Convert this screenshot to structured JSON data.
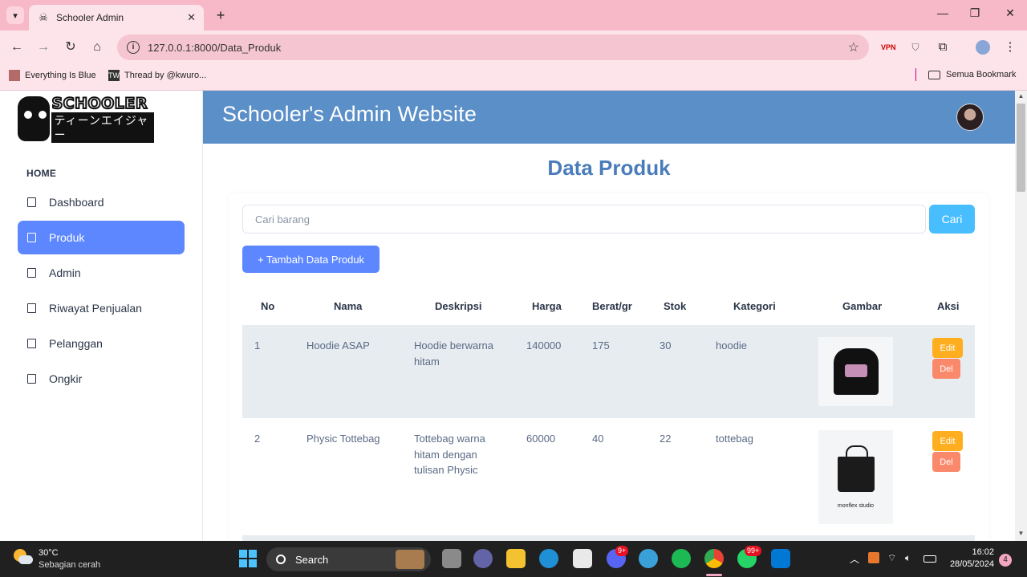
{
  "browser": {
    "tab_title": "Schooler Admin",
    "url": "127.0.0.1:8000/Data_Produk",
    "bookmarks": [
      "Everything Is Blue",
      "Thread by @kwuro..."
    ],
    "all_bookmarks_label": "Semua Bookmark"
  },
  "sidebar": {
    "logo_text": "SCHOOLER",
    "logo_subtext": "ティーンエイジャー",
    "section_heading": "HOME",
    "items": [
      {
        "label": "Dashboard"
      },
      {
        "label": "Produk"
      },
      {
        "label": "Admin"
      },
      {
        "label": "Riwayat Penjualan"
      },
      {
        "label": "Pelanggan"
      },
      {
        "label": "Ongkir"
      }
    ],
    "active_item": "Produk"
  },
  "header": {
    "title": "Schooler's Admin Website"
  },
  "main": {
    "page_title": "Data Produk",
    "search": {
      "placeholder": "Cari barang",
      "button_label": "Cari"
    },
    "add_button_label": "+ Tambah Data Produk",
    "table": {
      "columns": [
        "No",
        "Nama",
        "Deskripsi",
        "Harga",
        "Berat/gr",
        "Stok",
        "Kategori",
        "Gambar",
        "Aksi"
      ],
      "rows": [
        {
          "no": "1",
          "nama": "Hoodie ASAP",
          "deskripsi_lines": [
            "Hoodie berwarna",
            "hitam"
          ],
          "harga": "140000",
          "berat": "175",
          "stok": "30",
          "kategori": "hoodie",
          "gambar_caption": ""
        },
        {
          "no": "2",
          "nama": "Physic Tottebag",
          "deskripsi_lines": [
            "Tottebag warna",
            "hitam dengan",
            "tulisan Physic"
          ],
          "harga": "60000",
          "berat": "40",
          "stok": "22",
          "kategori": "tottebag",
          "gambar_caption": "monflex studio"
        }
      ],
      "edit_label": "Edit",
      "delete_label": "Del"
    }
  },
  "taskbar": {
    "weather_temp": "30°C",
    "weather_condition": "Sebagian cerah",
    "search_label": "Search",
    "discord_badge": "9+",
    "whatsapp_badge": "99+",
    "time": "16:02",
    "date": "28/05/2024",
    "notification_count": "4"
  },
  "colors": {
    "browser_tab_strip": "#f7b8c8",
    "header_bg": "#5a8fc8",
    "primary": "#5d87ff",
    "search_button": "#49beff",
    "edit_button": "#ffae1f",
    "delete_button": "#fa896b",
    "page_title": "#4a7cba"
  }
}
